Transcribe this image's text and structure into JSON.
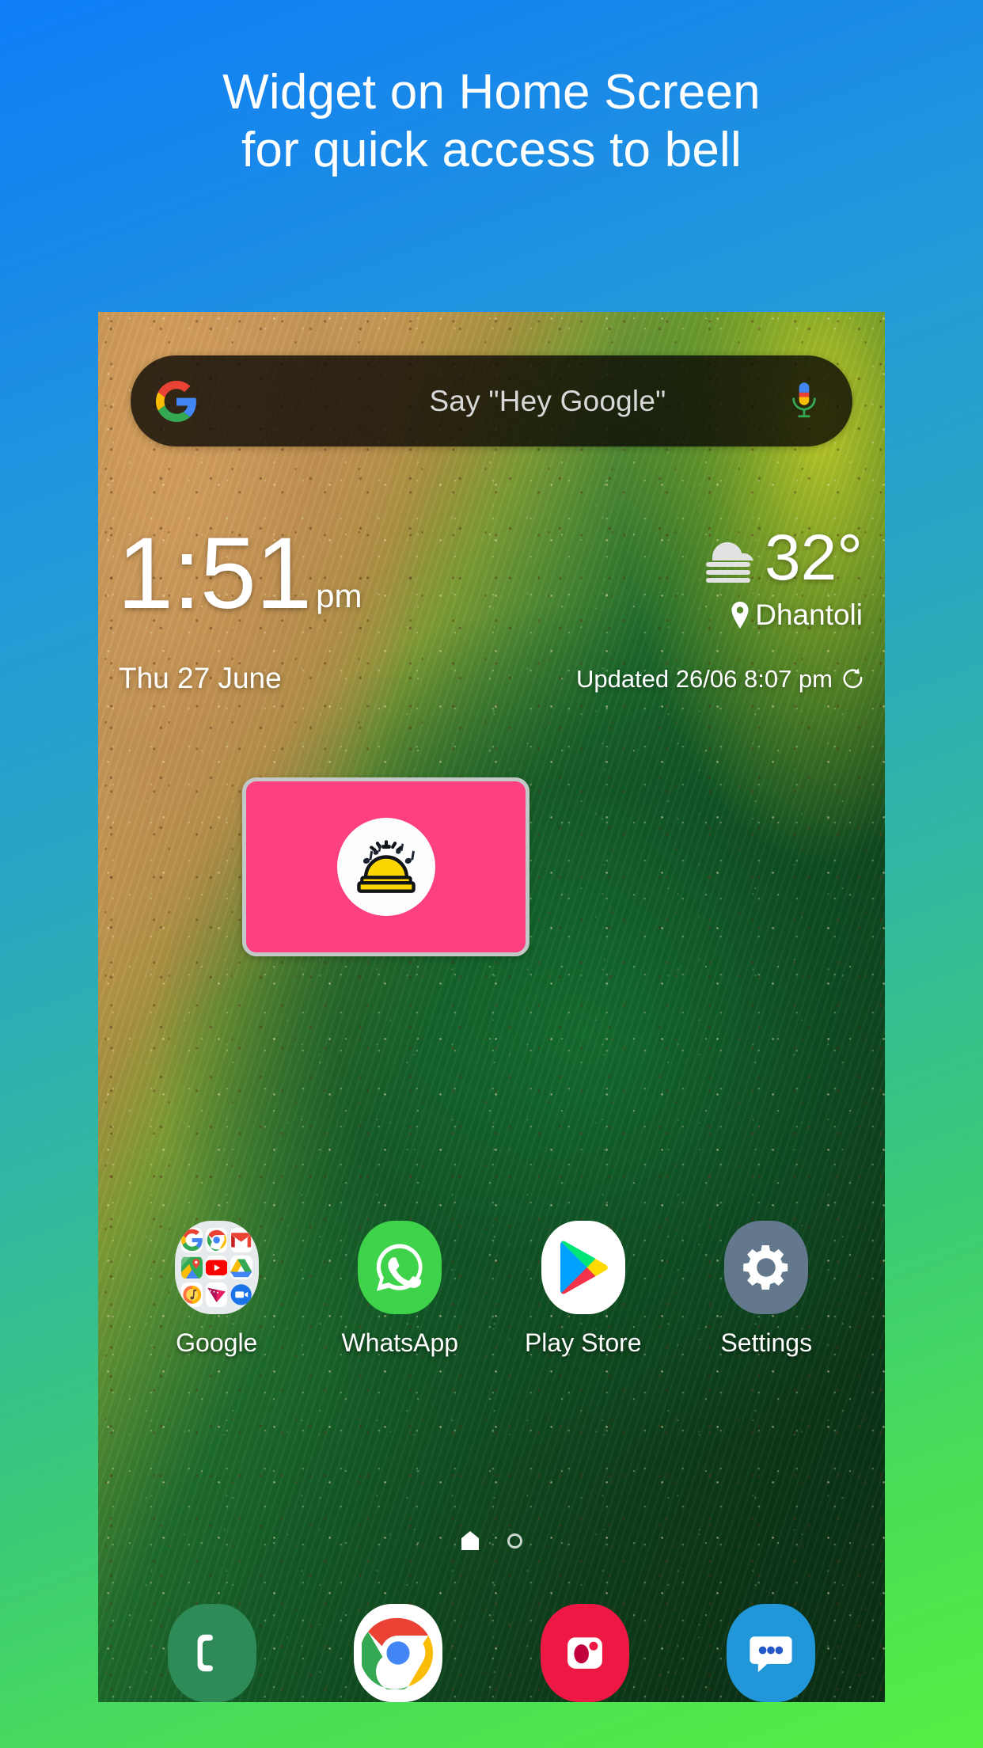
{
  "promo": {
    "headline": "Widget on Home Screen\nfor quick access to bell",
    "background_from": "#0d7ef7",
    "background_to": "#55ef44"
  },
  "phone": {
    "search": {
      "placeholder": "Say \"Hey Google\"",
      "google_icon": "google-g-icon",
      "mic_icon": "microphone-icon"
    },
    "clock": {
      "time": "1:51",
      "ampm": "pm",
      "date": "Thu 27 June"
    },
    "weather": {
      "condition_icon": "haze-cloud-icon",
      "temperature": "32°",
      "location": "Dhantoli",
      "location_icon": "map-pin-icon",
      "updated": "Updated 26/06 8:07 pm",
      "refresh_icon": "refresh-icon"
    },
    "widget": {
      "name": "bell-widget",
      "background_color": "#fc4080",
      "border_color": "#c3c8c9",
      "icon": "service-bell-icon",
      "icon_color": "#fdd600",
      "circle_color": "#ffffff"
    },
    "apps": [
      {
        "label": "Google",
        "icon": "google-folder-icon",
        "folder_items": [
          "google-icon",
          "chrome-icon",
          "gmail-icon",
          "maps-icon",
          "youtube-icon",
          "drive-icon",
          "play-music-icon",
          "play-movies-icon",
          "duo-icon"
        ]
      },
      {
        "label": "WhatsApp",
        "icon": "whatsapp-icon"
      },
      {
        "label": "Play Store",
        "icon": "play-store-icon"
      },
      {
        "label": "Settings",
        "icon": "settings-gear-icon"
      }
    ],
    "page_indicator": {
      "home_icon": "home-page-icon",
      "dots": 1
    },
    "dock": [
      {
        "label": "Phone",
        "icon": "phone-icon"
      },
      {
        "label": "Chrome",
        "icon": "chrome-icon"
      },
      {
        "label": "Camera",
        "icon": "camera-icon"
      },
      {
        "label": "Messages",
        "icon": "messages-icon"
      }
    ]
  }
}
